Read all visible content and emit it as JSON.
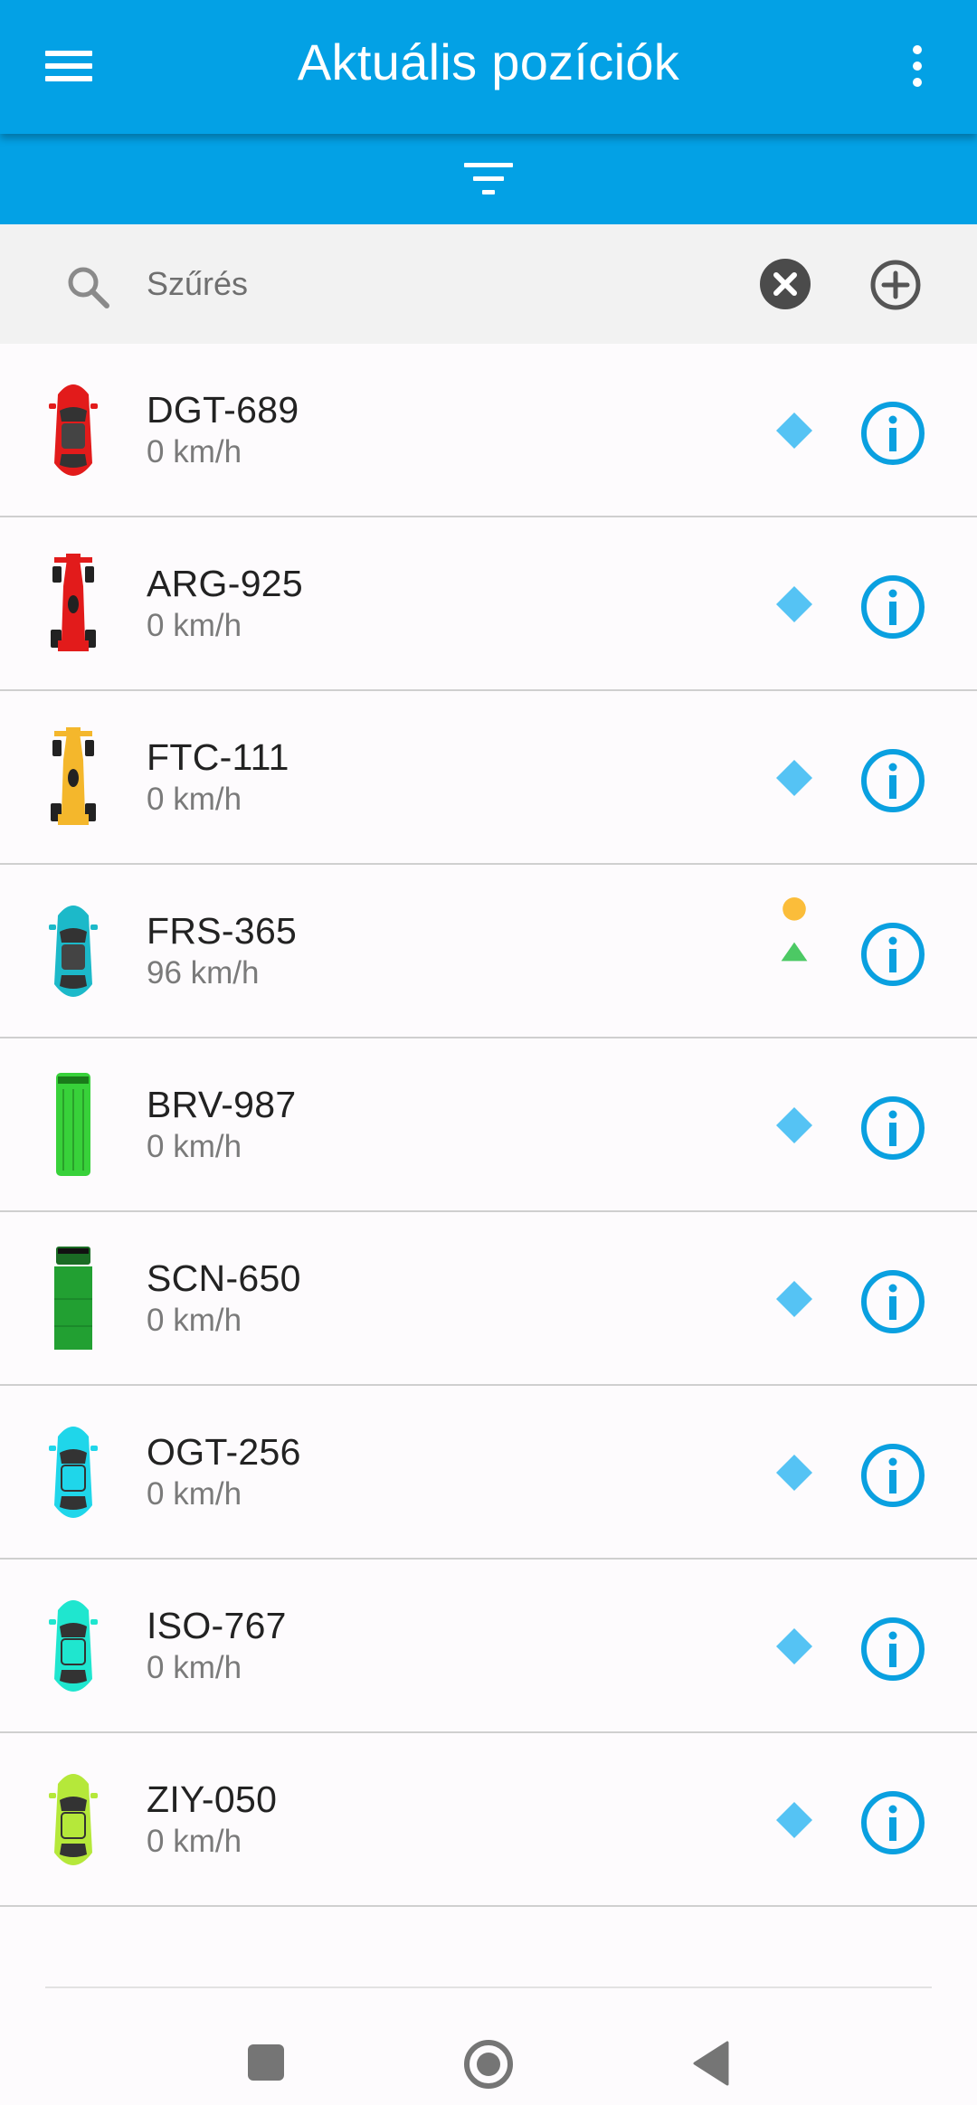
{
  "header": {
    "title": "Aktuális pozíciók",
    "menu_icon": "hamburger-menu-icon",
    "more_icon": "more-vertical-icon",
    "background": "#03a1e5"
  },
  "filter_bar": {
    "icon": "filter-icon"
  },
  "search": {
    "placeholder": "Szűrés",
    "value": "",
    "search_icon": "search-icon",
    "clear_icon": "clear-circle-icon",
    "add_icon": "add-circle-icon"
  },
  "vehicles": [
    {
      "plate": "DGT-689",
      "speed": "0 km/h",
      "car_icon": "red-convertible-icon",
      "car_color": "#e21b1b",
      "status": "diamond",
      "status_color": "#55c3f4"
    },
    {
      "plate": "ARG-925",
      "speed": "0 km/h",
      "car_icon": "red-formula-car-icon",
      "car_color": "#e21b1b",
      "status": "diamond",
      "status_color": "#55c3f4"
    },
    {
      "plate": "FTC-111",
      "speed": "0 km/h",
      "car_icon": "yellow-formula-car-icon",
      "car_color": "#f4b72c",
      "status": "diamond",
      "status_color": "#55c3f4"
    },
    {
      "plate": "FRS-365",
      "speed": "96 km/h",
      "car_icon": "teal-convertible-icon",
      "car_color": "#1cb9c9",
      "status": "moving",
      "status_color": "#fbbd3a"
    },
    {
      "plate": "BRV-987",
      "speed": "0 km/h",
      "car_icon": "green-van-icon",
      "car_color": "#38d13a",
      "status": "diamond",
      "status_color": "#55c3f4"
    },
    {
      "plate": "SCN-650",
      "speed": "0 km/h",
      "car_icon": "green-truck-icon",
      "car_color": "#22a032",
      "status": "diamond",
      "status_color": "#55c3f4"
    },
    {
      "plate": "OGT-256",
      "speed": "0 km/h",
      "car_icon": "cyan-sedan-icon",
      "car_color": "#1fd6ea",
      "status": "diamond",
      "status_color": "#55c3f4"
    },
    {
      "plate": "ISO-767",
      "speed": "0 km/h",
      "car_icon": "aqua-sports-car-icon",
      "car_color": "#1fe6cf",
      "status": "diamond",
      "status_color": "#55c3f4"
    },
    {
      "plate": "ZIY-050",
      "speed": "0 km/h",
      "car_icon": "lime-hatchback-icon",
      "car_color": "#b5e83a",
      "status": "diamond",
      "status_color": "#55c3f4"
    }
  ],
  "info_icon": "info-circle-icon",
  "info_color": "#0aa0e0",
  "nav": {
    "recents_icon": "recents-square-icon",
    "home_icon": "home-circle-icon",
    "back_icon": "back-triangle-icon"
  }
}
